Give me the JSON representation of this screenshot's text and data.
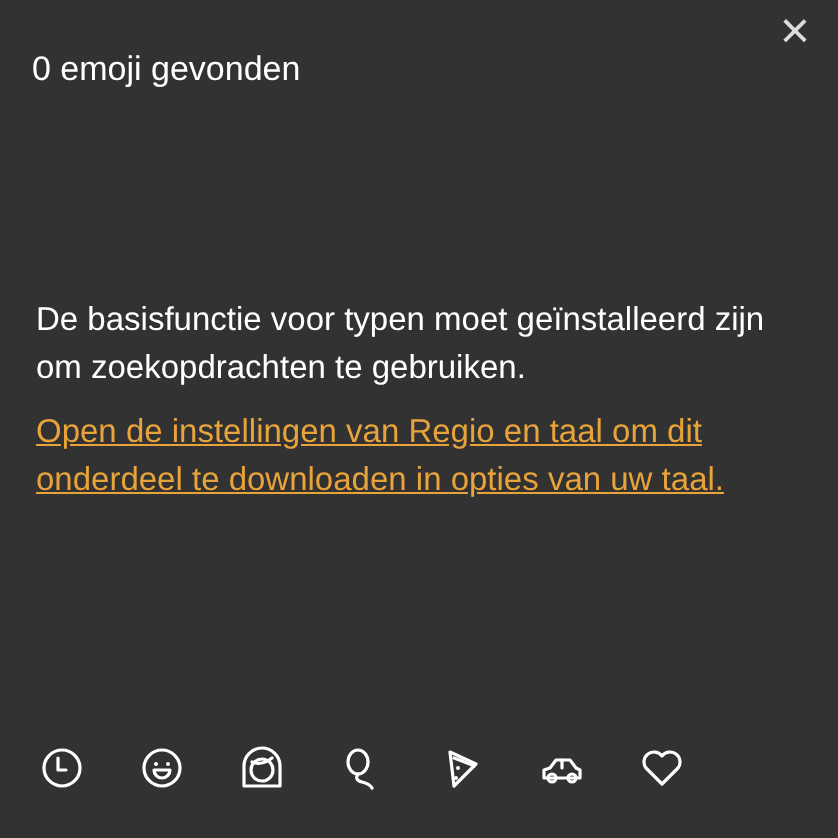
{
  "header": {
    "title": "0 emoji gevonden",
    "close": "×"
  },
  "message": {
    "text": "De basisfunctie voor typen moet geïnstalleerd zijn om zoekopdrachten te gebruiken.",
    "link": "Open de instellingen van Regio en taal om dit onderdeel te downloaden in opties van uw taal."
  }
}
